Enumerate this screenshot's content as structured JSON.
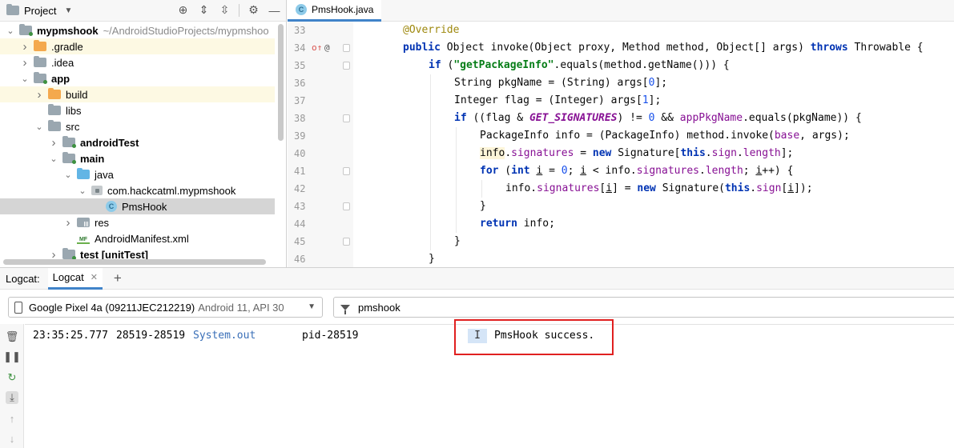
{
  "project_panel": {
    "title": "Project",
    "tree": [
      {
        "label": "mypmshook",
        "bold": true,
        "path": "~/AndroidStudioProjects/mypmshoo",
        "depth": 0,
        "expanded": true,
        "icon": "module-folder"
      },
      {
        "label": ".gradle",
        "depth": 1,
        "expanded": false,
        "icon": "folder-orange",
        "highlight": true
      },
      {
        "label": ".idea",
        "depth": 1,
        "expanded": false,
        "icon": "folder-gray"
      },
      {
        "label": "app",
        "bold": true,
        "depth": 1,
        "expanded": true,
        "icon": "module-folder"
      },
      {
        "label": "build",
        "depth": 2,
        "expanded": false,
        "icon": "folder-orange",
        "highlight": true
      },
      {
        "label": "libs",
        "depth": 2,
        "icon": "folder-gray"
      },
      {
        "label": "src",
        "depth": 2,
        "expanded": true,
        "icon": "folder-gray"
      },
      {
        "label": "androidTest",
        "bold": true,
        "depth": 3,
        "expanded": false,
        "icon": "module-folder"
      },
      {
        "label": "main",
        "bold": true,
        "depth": 3,
        "expanded": true,
        "icon": "module-folder"
      },
      {
        "label": "java",
        "depth": 4,
        "expanded": true,
        "icon": "folder-blue"
      },
      {
        "label": "com.hackcatml.mypmshook",
        "depth": 5,
        "expanded": true,
        "icon": "package"
      },
      {
        "label": "PmsHook",
        "depth": 6,
        "icon": "class",
        "selected": true
      },
      {
        "label": "res",
        "depth": 4,
        "expanded": false,
        "icon": "res-folder"
      },
      {
        "label": "AndroidManifest.xml",
        "depth": 4,
        "icon": "manifest"
      },
      {
        "label": "test [unitTest]",
        "bold": true,
        "depth": 3,
        "expanded": false,
        "icon": "module-folder"
      }
    ]
  },
  "editor": {
    "tab_label": "PmsHook.java",
    "tab_icon_letter": "C",
    "lines": [
      {
        "n": "33",
        "indent": 1,
        "html": "<span class=\"an\">@Override</span>"
      },
      {
        "n": "34",
        "indent": 1,
        "html": "<span class=\"kw\">public</span> Object invoke(Object proxy, Method method, Object[] args) <span class=\"kw\">throws</span> Throwable {"
      },
      {
        "n": "35",
        "indent": 2,
        "html": "<span class=\"kw\">if</span> (<span class=\"st\">\"getPackageInfo\"</span>.equals(method.getName())) {"
      },
      {
        "n": "36",
        "indent": 3,
        "html": "String pkgName = (String) args[<span class=\"nm\">0</span>];"
      },
      {
        "n": "37",
        "indent": 3,
        "html": "Integer flag = (Integer) args[<span class=\"nm\">1</span>];"
      },
      {
        "n": "38",
        "indent": 3,
        "html": "<span class=\"kw\">if</span> ((flag &amp; <span class=\"sf\">GET_SIGNATURES</span>) != <span class=\"nm\">0</span> &amp;&amp; <span class=\"fd\">appPkgName</span>.equals(pkgName)) {"
      },
      {
        "n": "39",
        "indent": 4,
        "html": "PackageInfo info = (PackageInfo) method.invoke(<span class=\"fd\">base</span>, args);"
      },
      {
        "n": "40",
        "indent": 4,
        "html": "<span class=\"ins\">info</span>.<span class=\"fd\">signatures</span> = <span class=\"kw\">new</span> Signature[<span class=\"kw\">this</span>.<span class=\"fd\">sign</span>.<span class=\"fd\">length</span>];"
      },
      {
        "n": "41",
        "indent": 4,
        "html": "<span class=\"kw\">for</span> (<span class=\"kw\">int</span> <span class=\"var-u\">i</span> = <span class=\"nm\">0</span>; <span class=\"var-u\">i</span> &lt; info.<span class=\"fd\">signatures</span>.<span class=\"fd\">length</span>; <span class=\"var-u\">i</span>++) {"
      },
      {
        "n": "42",
        "indent": 5,
        "html": "info.<span class=\"fd\">signatures</span>[<span class=\"var-u\">i</span>] = <span class=\"kw\">new</span> Signature(<span class=\"kw\">this</span>.<span class=\"fd\">sign</span>[<span class=\"var-u\">i</span>]);"
      },
      {
        "n": "43",
        "indent": 4,
        "html": "}"
      },
      {
        "n": "44",
        "indent": 4,
        "html": "<span class=\"kw\">return</span> info;"
      },
      {
        "n": "45",
        "indent": 3,
        "html": "}"
      },
      {
        "n": "46",
        "indent": 2,
        "html": "}"
      }
    ],
    "fold_lines": [
      "34",
      "35",
      "38",
      "41",
      "43",
      "45"
    ]
  },
  "logcat": {
    "prefix": "Logcat:",
    "tab_label": "Logcat",
    "device": "Google Pixel 4a (09211JEC212219)",
    "device_api": "Android 11, API 30",
    "filter": "pmshook",
    "log_entry": {
      "time": "23:35:25.777",
      "pid_tid": "28519-28519",
      "tag": "System.out",
      "package": "pid-28519",
      "level": "I",
      "message": "PmsHook success."
    }
  },
  "colors": {
    "accent": "#4083c9",
    "highlight_box": "#e02020",
    "keyword": "#0033b3",
    "string": "#067d17",
    "field": "#871094"
  }
}
